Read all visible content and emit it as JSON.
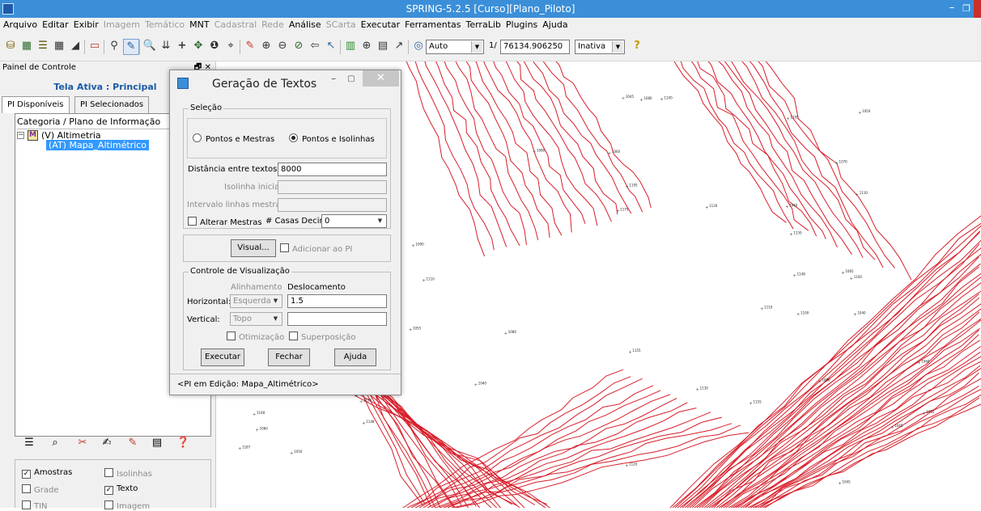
{
  "window": {
    "title": "SPRING-5.2.5 [Curso][Plano_Piloto]",
    "min_symbol": "–",
    "max_symbol": "❐"
  },
  "menu": [
    {
      "label": "Arquivo",
      "enabled": true
    },
    {
      "label": "Editar",
      "enabled": true
    },
    {
      "label": "Exibir",
      "enabled": true
    },
    {
      "label": "Imagem",
      "enabled": false
    },
    {
      "label": "Temático",
      "enabled": false
    },
    {
      "label": "MNT",
      "enabled": true
    },
    {
      "label": "Cadastral",
      "enabled": false
    },
    {
      "label": "Rede",
      "enabled": false
    },
    {
      "label": "Análise",
      "enabled": true
    },
    {
      "label": "SCarta",
      "enabled": false
    },
    {
      "label": "Executar",
      "enabled": true
    },
    {
      "label": "Ferramentas",
      "enabled": true
    },
    {
      "label": "TerraLib",
      "enabled": true
    },
    {
      "label": "Plugins",
      "enabled": true
    },
    {
      "label": "Ajuda",
      "enabled": true
    }
  ],
  "toolbar": {
    "display_mode": "Auto",
    "scale_prefix": "1/",
    "scale_value": "76134.906250",
    "state": "Inativa"
  },
  "panel": {
    "header": "Painel de Controle",
    "header_icons": "🗗 ✕",
    "active_screen": "Tela Ativa : Principal",
    "tabs": [
      "PI Disponíveis",
      "PI Selecionados"
    ],
    "tree_header": "Categoria / Plano de Informação",
    "category": "(V) Altimetria",
    "category_icon": "M",
    "plan": "(AT) Mapa_Altimétrico",
    "checks": [
      {
        "label": "Amostras",
        "checked": true,
        "enabled": true
      },
      {
        "label": "Isolinhas",
        "checked": false,
        "enabled": false
      },
      {
        "label": "Grade",
        "checked": false,
        "enabled": false
      },
      {
        "label": "Texto",
        "checked": true,
        "enabled": true
      },
      {
        "label": "TIN",
        "checked": false,
        "enabled": false
      },
      {
        "label": "Imagem",
        "checked": false,
        "enabled": false
      }
    ]
  },
  "dialog": {
    "title": "Geração de Textos",
    "close_symbol": "✕",
    "selection_group": "Seleção",
    "radio_points_master": "Pontos e Mestras",
    "radio_points_isolines": "Pontos e Isolinhas",
    "selected_radio": "Pontos e Isolinhas",
    "distance_label": "Distância entre textos:",
    "distance_value": "8000",
    "initial_isoline_label": "Isolinha inicial:",
    "master_interval_label": "Intervalo linhas mestras:",
    "alter_master_label": "Alterar Mestras",
    "decimals_label": "# Casas Decimais:",
    "decimals_value": "0",
    "visual_button": "Visual...",
    "add_to_pi_label": "Adicionar ao PI",
    "view_control_group": "Controle de Visualização",
    "alignment_header": "Alinhamento",
    "offset_header": "Deslocamento",
    "horizontal_label": "Horizontal:",
    "horizontal_align": "Esquerda",
    "horizontal_offset": "1.5",
    "vertical_label": "Vertical:",
    "vertical_align": "Topo",
    "vertical_offset": "",
    "optimization_label": "Otimização",
    "overlap_label": "Superposição",
    "execute_button": "Executar",
    "close_button": "Fechar",
    "help_button": "Ajuda",
    "status": "<PI em Edição: Mapa_Altimétrico>"
  },
  "map": {
    "contour_color": "#d81e2a",
    "labels": [
      "1040",
      "1045",
      "1050",
      "1055",
      "1060",
      "1065",
      "1070",
      "1080",
      "1090",
      "1100",
      "1110",
      "1120",
      "1130",
      "1148",
      "1155",
      "1175",
      "1187",
      "1195"
    ]
  }
}
